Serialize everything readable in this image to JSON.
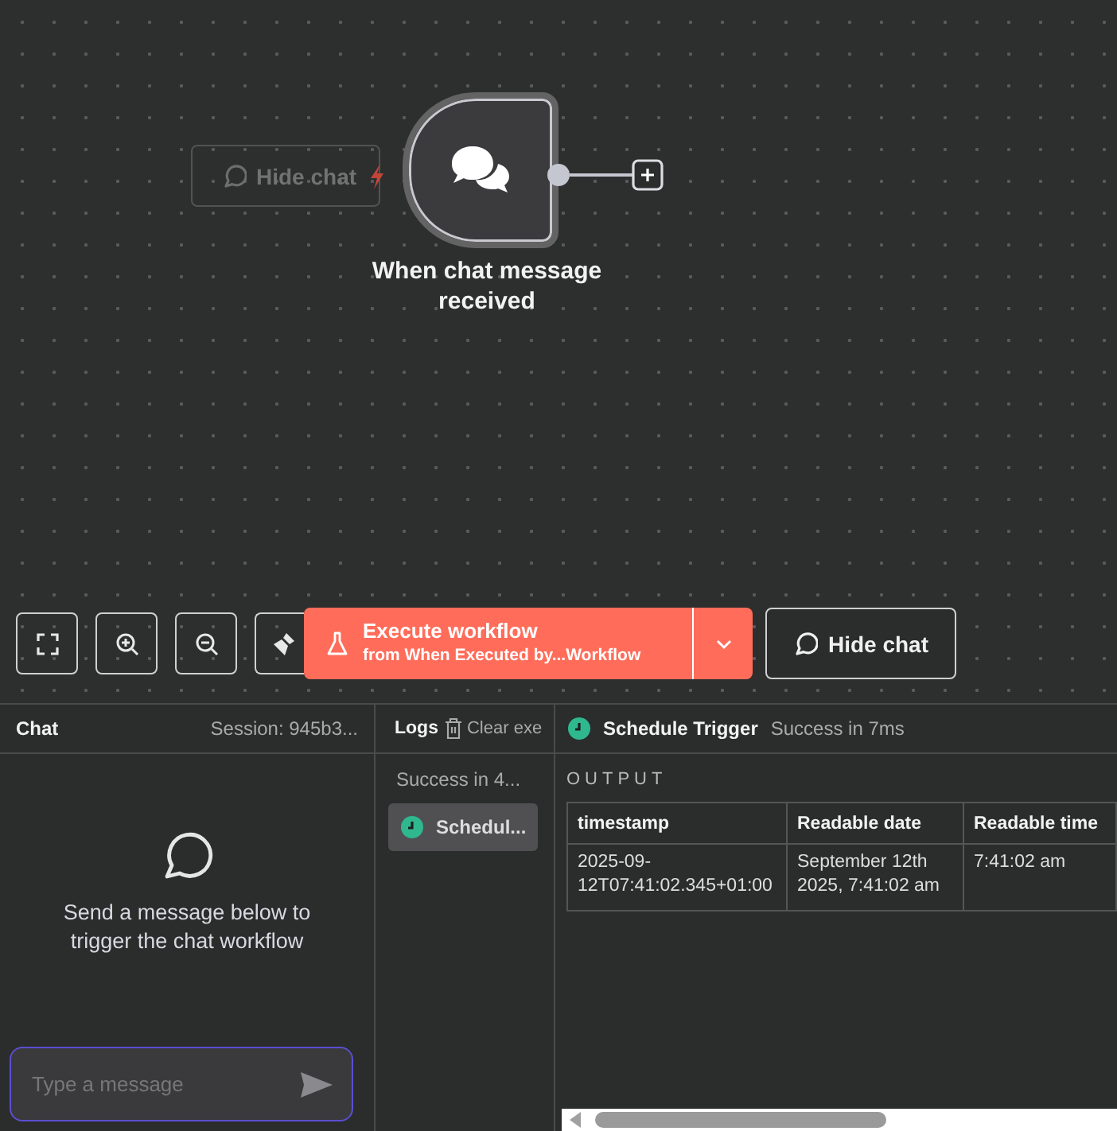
{
  "canvas": {
    "ghost_button": {
      "label": "Hide chat"
    },
    "node": {
      "label": "When chat message received"
    }
  },
  "toolbar": {
    "icon_buttons": [
      {
        "kind": "fit"
      },
      {
        "kind": "zoom-in"
      },
      {
        "kind": "zoom-out"
      },
      {
        "kind": "clean"
      }
    ],
    "execute": {
      "label": "Execute workflow",
      "sublabel": "from When Executed by...Workflow"
    },
    "hide_chat": {
      "label": "Hide chat"
    }
  },
  "chat": {
    "title": "Chat",
    "session": "Session: 945b3...",
    "empty_message": "Send a message below to trigger the chat workflow",
    "input": {
      "placeholder": "Type a message"
    }
  },
  "logs": {
    "title": "Logs",
    "clear": "Clear exe",
    "summary": "Success in 4...",
    "entries": [
      {
        "label": "Schedul...",
        "selected": true
      }
    ]
  },
  "output": {
    "title": "Schedule Trigger",
    "status": "Success in 7ms",
    "section": "OUTPUT",
    "table": {
      "columns": [
        "timestamp",
        "Readable date",
        "Readable time"
      ],
      "rows": [
        [
          "2025-09-12T07:41:02.345+01:00",
          "September 12th 2025, 7:41:02 am",
          "7:41:02 am"
        ]
      ]
    }
  }
}
